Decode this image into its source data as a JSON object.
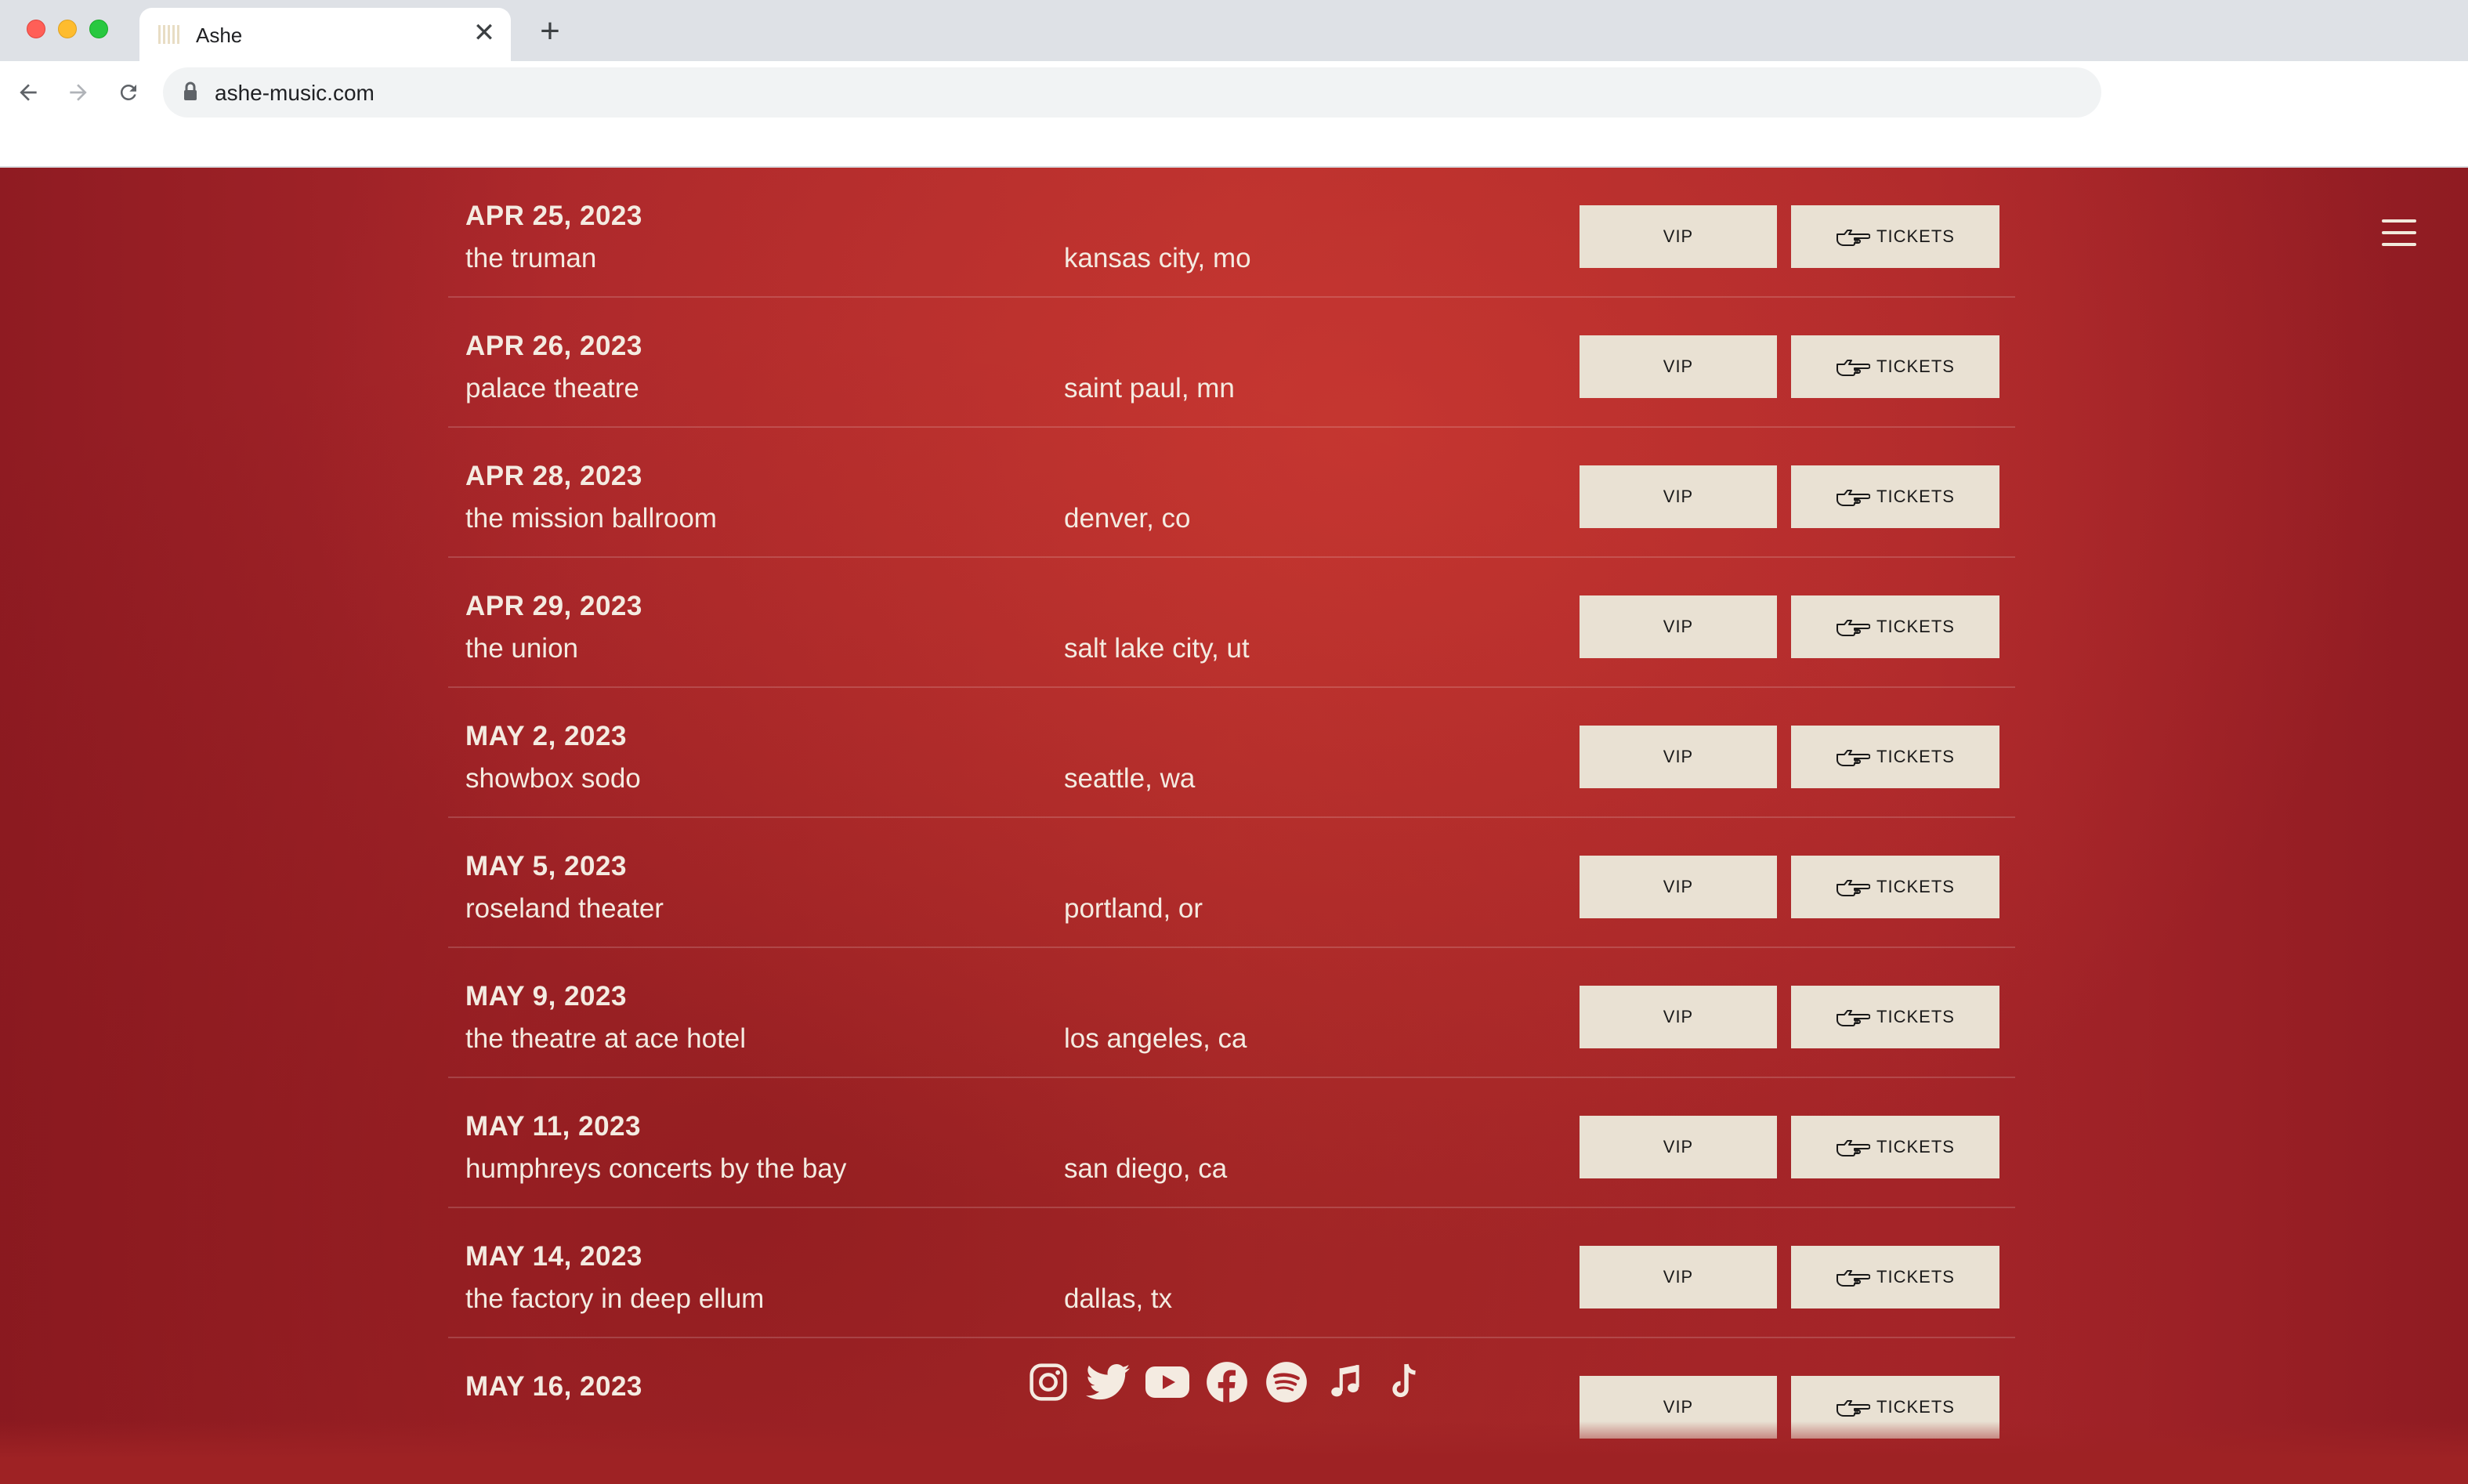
{
  "browser": {
    "tab_title": "Ashe",
    "tab_close": "✕",
    "new_tab": "+",
    "url": "ashe-music.com"
  },
  "colors": {
    "page_bg": "#a8262a",
    "button_bg": "#e9e1d3",
    "text": "#f4ebe1"
  },
  "tour": {
    "vip_label": "VIP",
    "tickets_label": "TICKETS",
    "dates": [
      {
        "date": "APR 25, 2023",
        "venue": "the truman",
        "city": "kansas city, mo"
      },
      {
        "date": "APR 26, 2023",
        "venue": "palace theatre",
        "city": "saint paul, mn"
      },
      {
        "date": "APR 28, 2023",
        "venue": "the mission ballroom",
        "city": "denver, co"
      },
      {
        "date": "APR 29, 2023",
        "venue": "the union",
        "city": "salt lake city, ut"
      },
      {
        "date": "MAY 2, 2023",
        "venue": "showbox sodo",
        "city": "seattle, wa"
      },
      {
        "date": "MAY 5, 2023",
        "venue": "roseland theater",
        "city": "portland, or"
      },
      {
        "date": "MAY 9, 2023",
        "venue": "the theatre at ace hotel",
        "city": "los angeles, ca"
      },
      {
        "date": "MAY 11, 2023",
        "venue": "humphreys concerts by the bay",
        "city": "san diego, ca"
      },
      {
        "date": "MAY 14, 2023",
        "venue": "the factory in deep ellum",
        "city": "dallas, tx"
      },
      {
        "date": "MAY 16, 2023",
        "venue": "",
        "city": ""
      }
    ]
  },
  "social": [
    "instagram-icon",
    "twitter-icon",
    "youtube-icon",
    "facebook-icon",
    "spotify-icon",
    "apple-music-icon",
    "tiktok-icon"
  ]
}
